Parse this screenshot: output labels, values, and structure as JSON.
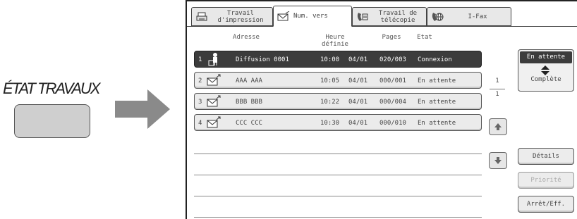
{
  "callout": {
    "key_label": "ÉTAT TRAVAUX"
  },
  "tabs": [
    {
      "label": "Travail\nd'impression",
      "icon": "printer-icon",
      "active": false
    },
    {
      "label": "Num. vers",
      "icon": "scan-envelope-icon",
      "active": true
    },
    {
      "label": "Travail de\ntélécopie",
      "icon": "fax-icon",
      "active": false
    },
    {
      "label": "I-Fax",
      "icon": "internet-fax-icon",
      "active": false
    }
  ],
  "columns": {
    "address": "Adresse",
    "time": "Heure\ndéfinie",
    "pages": "Pages",
    "status": "Etat"
  },
  "jobs": [
    {
      "num": "1",
      "icon": "broadcast-icon",
      "address": "Diffusion 0001",
      "time": "10:00",
      "date": "04/01",
      "pages": "020/003",
      "status": "Connexion",
      "selected": true
    },
    {
      "num": "2",
      "icon": "email-icon",
      "address": "AAA AAA",
      "time": "10:05",
      "date": "04/01",
      "pages": "000/001",
      "status": "En attente",
      "selected": false
    },
    {
      "num": "3",
      "icon": "email-icon",
      "address": "BBB BBB",
      "time": "10:22",
      "date": "04/01",
      "pages": "000/004",
      "status": "En attente",
      "selected": false
    },
    {
      "num": "4",
      "icon": "email-icon",
      "address": "CCC CCC",
      "time": "10:30",
      "date": "04/01",
      "pages": "000/010",
      "status": "En attente",
      "selected": false
    }
  ],
  "pagination": {
    "current": "1",
    "total": "1"
  },
  "sort": {
    "top": "En attente",
    "bottom": "Complète"
  },
  "buttons": {
    "details": "Détails",
    "priority": "Priorité",
    "stop_delete": "Arrêt/Eff."
  },
  "colors": {
    "selected_row": "#3c3c3c",
    "row_bg": "#ebebeb",
    "key_button": "#cfcfcf",
    "arrow": "#8a8a8a"
  }
}
